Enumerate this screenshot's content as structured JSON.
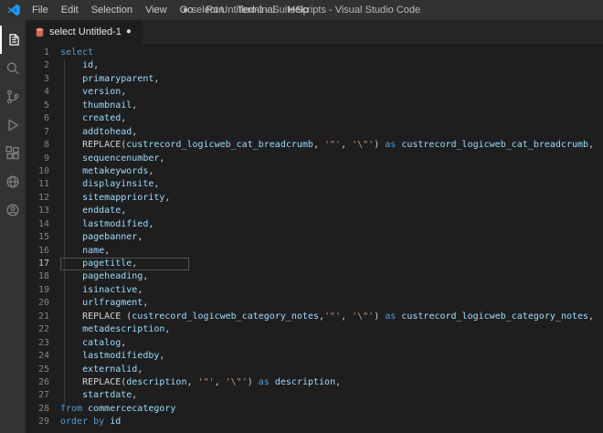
{
  "title_bar": {
    "menus": [
      "File",
      "Edit",
      "Selection",
      "View",
      "Go",
      "Run",
      "Terminal",
      "Help"
    ],
    "title": "● select Untitled-1 - SuiteScripts - Visual Studio Code"
  },
  "activity_bar": {
    "icons": [
      "explorer-icon",
      "search-icon",
      "source-control-icon",
      "run-debug-icon",
      "extensions-icon",
      "remote-globe-icon",
      "account-icon"
    ]
  },
  "tab_bar": {
    "active_tab": {
      "label": "select Untitled-1",
      "modified": true,
      "modified_indicator": "●"
    }
  },
  "editor": {
    "language": "sql",
    "current_line": 17,
    "token_colors": {
      "kw": "#569cd6",
      "id": "#9cdcfe",
      "pl": "#d4d4d4",
      "str": "#ce9178"
    },
    "lines": [
      {
        "num": 1,
        "tokens": [
          [
            "kw",
            "select"
          ]
        ]
      },
      {
        "num": 2,
        "tokens": [
          [
            "pl",
            "    "
          ],
          [
            "id",
            "id"
          ],
          [
            "pl",
            ","
          ]
        ]
      },
      {
        "num": 3,
        "tokens": [
          [
            "pl",
            "    "
          ],
          [
            "id",
            "primaryparent"
          ],
          [
            "pl",
            ","
          ]
        ]
      },
      {
        "num": 4,
        "tokens": [
          [
            "pl",
            "    "
          ],
          [
            "id",
            "version"
          ],
          [
            "pl",
            ","
          ]
        ]
      },
      {
        "num": 5,
        "tokens": [
          [
            "pl",
            "    "
          ],
          [
            "id",
            "thumbnail"
          ],
          [
            "pl",
            ","
          ]
        ]
      },
      {
        "num": 6,
        "tokens": [
          [
            "pl",
            "    "
          ],
          [
            "id",
            "created"
          ],
          [
            "pl",
            ","
          ]
        ]
      },
      {
        "num": 7,
        "tokens": [
          [
            "pl",
            "    "
          ],
          [
            "id",
            "addtohead"
          ],
          [
            "pl",
            ","
          ]
        ]
      },
      {
        "num": 8,
        "tokens": [
          [
            "pl",
            "    REPLACE("
          ],
          [
            "id",
            "custrecord_logicweb_cat_breadcrumb"
          ],
          [
            "pl",
            ", "
          ],
          [
            "str",
            "'\"'"
          ],
          [
            "pl",
            ", "
          ],
          [
            "str",
            "'\\\"'"
          ],
          [
            "pl",
            ") "
          ],
          [
            "kw",
            "as"
          ],
          [
            "pl",
            " "
          ],
          [
            "id",
            "custrecord_logicweb_cat_breadcrumb"
          ],
          [
            "pl",
            ","
          ]
        ]
      },
      {
        "num": 9,
        "tokens": [
          [
            "pl",
            "    "
          ],
          [
            "id",
            "sequencenumber"
          ],
          [
            "pl",
            ","
          ]
        ]
      },
      {
        "num": 10,
        "tokens": [
          [
            "pl",
            "    "
          ],
          [
            "id",
            "metakeywords"
          ],
          [
            "pl",
            ","
          ]
        ]
      },
      {
        "num": 11,
        "tokens": [
          [
            "pl",
            "    "
          ],
          [
            "id",
            "displayinsite"
          ],
          [
            "pl",
            ","
          ]
        ]
      },
      {
        "num": 12,
        "tokens": [
          [
            "pl",
            "    "
          ],
          [
            "id",
            "sitemappriority"
          ],
          [
            "pl",
            ","
          ]
        ]
      },
      {
        "num": 13,
        "tokens": [
          [
            "pl",
            "    "
          ],
          [
            "id",
            "enddate"
          ],
          [
            "pl",
            ","
          ]
        ]
      },
      {
        "num": 14,
        "tokens": [
          [
            "pl",
            "    "
          ],
          [
            "id",
            "lastmodified"
          ],
          [
            "pl",
            ","
          ]
        ]
      },
      {
        "num": 15,
        "tokens": [
          [
            "pl",
            "    "
          ],
          [
            "id",
            "pagebanner"
          ],
          [
            "pl",
            ","
          ]
        ]
      },
      {
        "num": 16,
        "tokens": [
          [
            "pl",
            "    "
          ],
          [
            "id",
            "name"
          ],
          [
            "pl",
            ","
          ]
        ]
      },
      {
        "num": 17,
        "tokens": [
          [
            "pl",
            "    "
          ],
          [
            "id",
            "pagetitle"
          ],
          [
            "pl",
            ","
          ]
        ]
      },
      {
        "num": 18,
        "tokens": [
          [
            "pl",
            "    "
          ],
          [
            "id",
            "pageheading"
          ],
          [
            "pl",
            ","
          ]
        ]
      },
      {
        "num": 19,
        "tokens": [
          [
            "pl",
            "    "
          ],
          [
            "id",
            "isinactive"
          ],
          [
            "pl",
            ","
          ]
        ]
      },
      {
        "num": 20,
        "tokens": [
          [
            "pl",
            "    "
          ],
          [
            "id",
            "urlfragment"
          ],
          [
            "pl",
            ","
          ]
        ]
      },
      {
        "num": 21,
        "tokens": [
          [
            "pl",
            "    REPLACE ("
          ],
          [
            "id",
            "custrecord_logicweb_category_notes"
          ],
          [
            "pl",
            ","
          ],
          [
            "str",
            "'\"'"
          ],
          [
            "pl",
            ", "
          ],
          [
            "str",
            "'\\\"'"
          ],
          [
            "pl",
            ") "
          ],
          [
            "kw",
            "as"
          ],
          [
            "pl",
            " "
          ],
          [
            "id",
            "custrecord_logicweb_category_notes"
          ],
          [
            "pl",
            ","
          ]
        ]
      },
      {
        "num": 22,
        "tokens": [
          [
            "pl",
            "    "
          ],
          [
            "id",
            "metadescription"
          ],
          [
            "pl",
            ","
          ]
        ]
      },
      {
        "num": 23,
        "tokens": [
          [
            "pl",
            "    "
          ],
          [
            "id",
            "catalog"
          ],
          [
            "pl",
            ","
          ]
        ]
      },
      {
        "num": 24,
        "tokens": [
          [
            "pl",
            "    "
          ],
          [
            "id",
            "lastmodifiedby"
          ],
          [
            "pl",
            ","
          ]
        ]
      },
      {
        "num": 25,
        "tokens": [
          [
            "pl",
            "    "
          ],
          [
            "id",
            "externalid"
          ],
          [
            "pl",
            ","
          ]
        ]
      },
      {
        "num": 26,
        "tokens": [
          [
            "pl",
            "    REPLACE("
          ],
          [
            "id",
            "description"
          ],
          [
            "pl",
            ", "
          ],
          [
            "str",
            "'\"'"
          ],
          [
            "pl",
            ", "
          ],
          [
            "str",
            "'\\\"'"
          ],
          [
            "pl",
            ") "
          ],
          [
            "kw",
            "as"
          ],
          [
            "pl",
            " "
          ],
          [
            "id",
            "description"
          ],
          [
            "pl",
            ","
          ]
        ]
      },
      {
        "num": 27,
        "tokens": [
          [
            "pl",
            "    "
          ],
          [
            "id",
            "startdate"
          ],
          [
            "pl",
            ","
          ]
        ]
      },
      {
        "num": 28,
        "tokens": [
          [
            "kw",
            "from"
          ],
          [
            "pl",
            " "
          ],
          [
            "id",
            "commercecategory"
          ]
        ]
      },
      {
        "num": 29,
        "tokens": [
          [
            "kw",
            "order"
          ],
          [
            "pl",
            " "
          ],
          [
            "kw",
            "by"
          ],
          [
            "pl",
            " "
          ],
          [
            "id",
            "id"
          ]
        ]
      }
    ]
  }
}
